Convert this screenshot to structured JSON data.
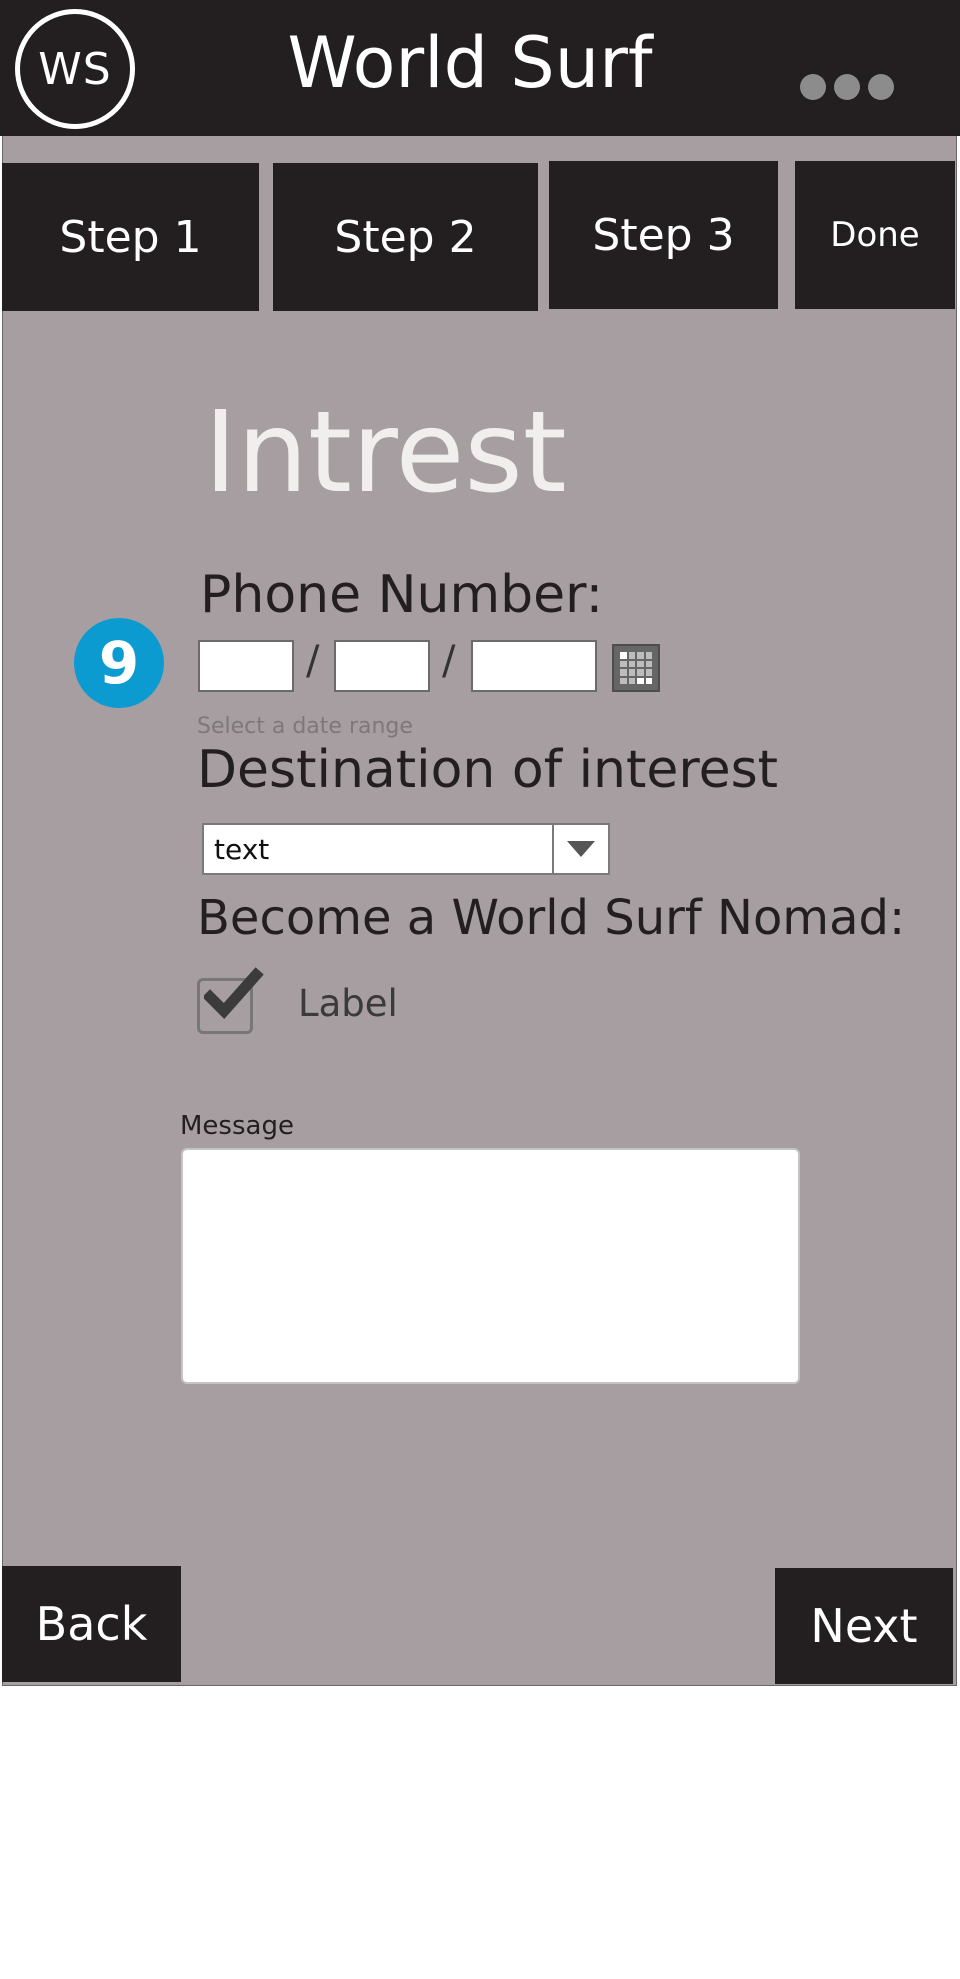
{
  "header": {
    "logo_text": "WS",
    "app_title": "World Surf",
    "menu_icon": "more-dots-icon"
  },
  "steps": [
    {
      "label": "Step 1"
    },
    {
      "label": "Step 2"
    },
    {
      "label": "Step 3"
    },
    {
      "label": "Done"
    }
  ],
  "main": {
    "page_title": "Intrest",
    "phone_label": "Phone Number:",
    "annotation_number": "9",
    "date_separator": "/",
    "date_hint": "Select a date range",
    "calendar_icon": "calendar-icon",
    "destination_label": "Destination of interest",
    "destination_value": "text",
    "nomad_label": "Become a World Surf Nomad:",
    "checkbox_label": "Label",
    "checkbox_checked": true,
    "message_label": "Message",
    "message_value": ""
  },
  "nav": {
    "back_label": "Back",
    "next_label": "Next"
  },
  "colors": {
    "header_bg": "#231f20",
    "page_bg": "#a69ea0",
    "badge": "#0b9bd1"
  }
}
